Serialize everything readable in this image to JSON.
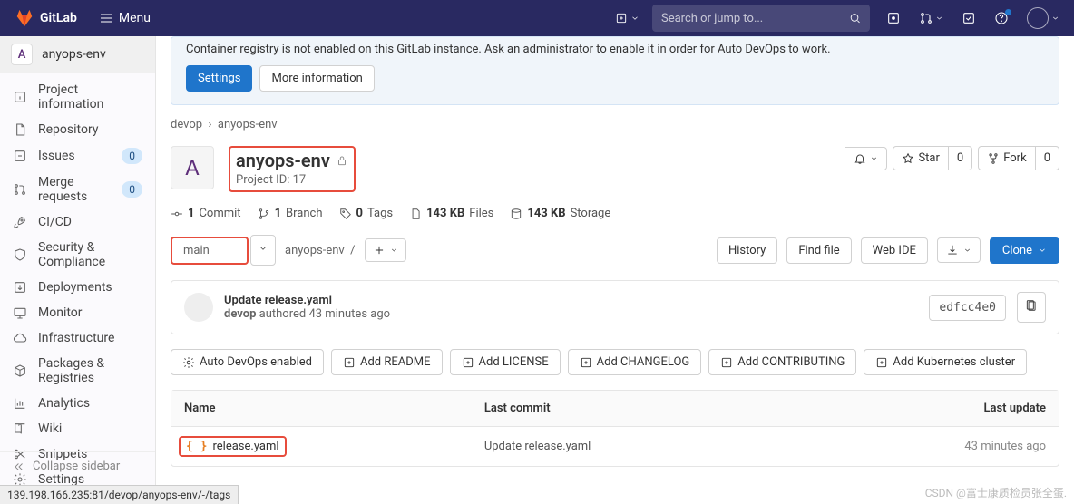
{
  "topnav": {
    "brand": "GitLab",
    "menu_label": "Menu",
    "search_placeholder": "Search or jump to..."
  },
  "sidebar": {
    "avatar_letter": "A",
    "title": "anyops-env",
    "items": [
      {
        "label": "Project information",
        "icon": "info-icon"
      },
      {
        "label": "Repository",
        "icon": "doc-icon"
      },
      {
        "label": "Issues",
        "icon": "issues-icon",
        "badge": "0"
      },
      {
        "label": "Merge requests",
        "icon": "mr-icon",
        "badge": "0"
      },
      {
        "label": "CI/CD",
        "icon": "rocket-icon"
      },
      {
        "label": "Security & Compliance",
        "icon": "shield-icon"
      },
      {
        "label": "Deployments",
        "icon": "deploy-icon"
      },
      {
        "label": "Monitor",
        "icon": "monitor-icon"
      },
      {
        "label": "Infrastructure",
        "icon": "cloud-icon"
      },
      {
        "label": "Packages & Registries",
        "icon": "package-icon"
      },
      {
        "label": "Analytics",
        "icon": "chart-icon"
      },
      {
        "label": "Wiki",
        "icon": "book-icon"
      },
      {
        "label": "Snippets",
        "icon": "scissors-icon"
      },
      {
        "label": "Settings",
        "icon": "gear-icon"
      }
    ],
    "collapse_label": "Collapse sidebar"
  },
  "banner": {
    "text": "Container registry is not enabled on this GitLab instance. Ask an administrator to enable it in order for Auto DevOps to work.",
    "settings_btn": "Settings",
    "more_info_btn": "More information"
  },
  "breadcrumb": {
    "group": "devop",
    "project": "anyops-env"
  },
  "project": {
    "avatar_letter": "A",
    "name": "anyops-env",
    "id_label": "Project ID: 17",
    "bell_label": "",
    "star_label": "Star",
    "star_count": "0",
    "fork_label": "Fork",
    "fork_count": "0"
  },
  "stats": {
    "commits_n": "1",
    "commits_l": "Commit",
    "branches_n": "1",
    "branches_l": "Branch",
    "tags_n": "0",
    "tags_l": "Tags",
    "files_n": "143 KB",
    "files_l": "Files",
    "storage_n": "143 KB",
    "storage_l": "Storage"
  },
  "controls": {
    "branch": "main",
    "path": "anyops-env",
    "history_btn": "History",
    "find_btn": "Find file",
    "webide_btn": "Web IDE",
    "clone_btn": "Clone"
  },
  "last_commit": {
    "title": "Update release.yaml",
    "author": "devop",
    "authored": " authored ",
    "time": "43 minutes ago",
    "sha": "edfcc4e0"
  },
  "quick_actions": [
    "Auto DevOps enabled",
    "Add README",
    "Add LICENSE",
    "Add CHANGELOG",
    "Add CONTRIBUTING",
    "Add Kubernetes cluster"
  ],
  "file_table": {
    "cols": {
      "name": "Name",
      "commit": "Last commit",
      "update": "Last update"
    },
    "rows": [
      {
        "name": "release.yaml",
        "commit": "Update release.yaml",
        "update": "43 minutes ago"
      }
    ]
  },
  "status_url": "139.198.166.235:81/devop/anyops-env/-/tags",
  "watermark": "CSDN @富士康质检员张全蛋."
}
